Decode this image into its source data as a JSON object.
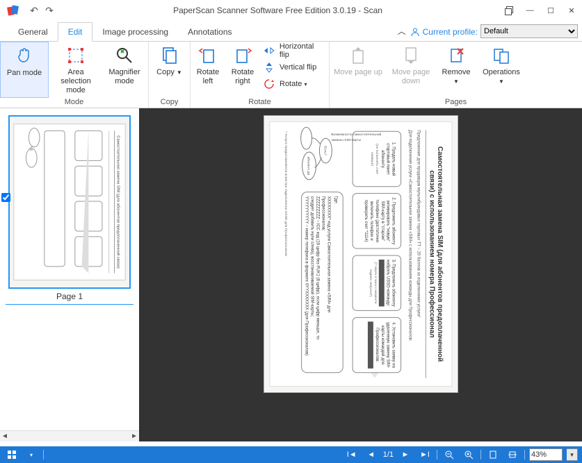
{
  "title": "PaperScan Scanner Software Free Edition 3.0.19 - Scan",
  "tabs": {
    "general": "General",
    "edit": "Edit",
    "image_processing": "Image processing",
    "annotations": "Annotations"
  },
  "profile": {
    "label": "Current profile:",
    "value": "Default"
  },
  "ribbon": {
    "mode": {
      "pan": "Pan mode",
      "area": "Area selection\nmode",
      "mag": "Magnifier\nmode",
      "group": "Mode"
    },
    "copy": {
      "btn": "Copy",
      "drop": "▼",
      "group": "Copy"
    },
    "rotate": {
      "left": "Rotate\nleft",
      "right": "Rotate\nright",
      "hflip": "Horizontal flip",
      "vflip": "Vertical flip",
      "rotate": "Rotate",
      "group": "Rotate"
    },
    "pages": {
      "up": "Move page up",
      "down": "Move page\ndown",
      "remove": "Remove",
      "ops": "Operations",
      "group": "Pages"
    }
  },
  "thumb": {
    "page_label": "Page 1"
  },
  "status": {
    "page": "1/1",
    "zoom": "43%"
  }
}
